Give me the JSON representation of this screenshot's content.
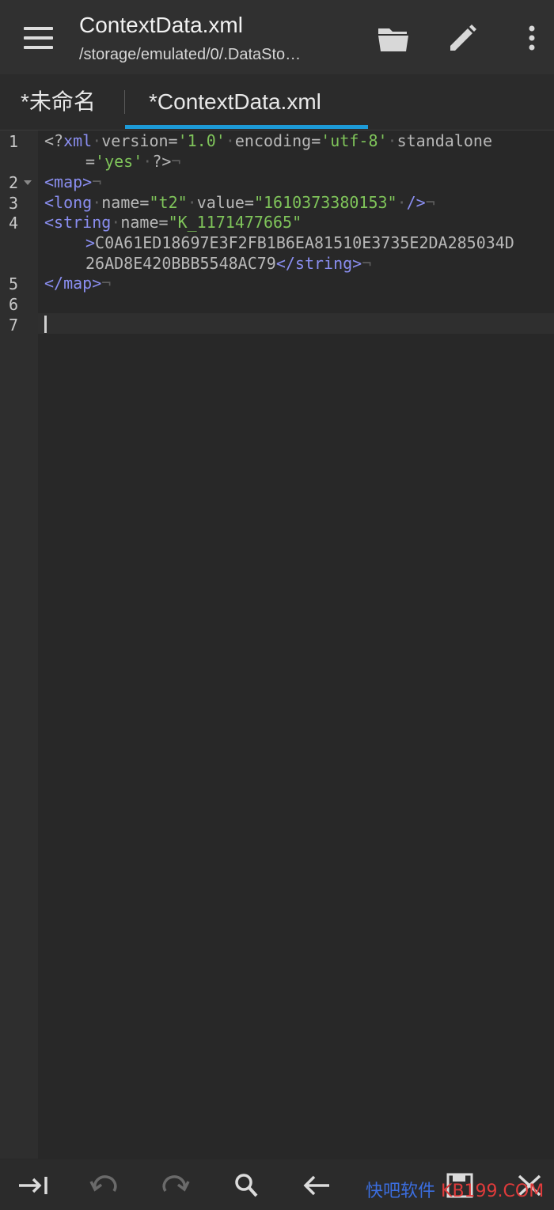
{
  "header": {
    "title": "ContextData.xml",
    "subtitle": "/storage/emulated/0/.DataSto…",
    "icons": [
      "menu-icon",
      "folder-open-icon",
      "pencil-icon",
      "more-vert-icon"
    ]
  },
  "tabs": [
    {
      "label": "*未命名",
      "active": false
    },
    {
      "label": "*ContextData.xml",
      "active": true
    }
  ],
  "editor": {
    "line_numbers": [
      "1",
      "2",
      "3",
      "4",
      "5",
      "6",
      "7"
    ],
    "line1a": {
      "p1": "<?",
      "t1": "xml",
      "d1": "·",
      "a1": "version=",
      "s1": "'1.0'",
      "d2": "·",
      "a2": "encoding=",
      "s2": "'utf-8'",
      "d3": "·",
      "a3": "standalone"
    },
    "line1b": {
      "a1": "=",
      "s1": "'yes'",
      "d1": "·",
      "p1": "?>",
      "e": "¬"
    },
    "line2": {
      "t1": "<map>",
      "e": "¬"
    },
    "line3": {
      "t1": "<long",
      "d1": "·",
      "a1": "name=",
      "s1": "\"t2\"",
      "d2": "·",
      "a2": "value=",
      "s2": "\"1610373380153\"",
      "d3": "·",
      "t2": "/>",
      "e": "¬"
    },
    "line4a": {
      "t1": "<string",
      "d1": "·",
      "a1": "name=",
      "s1": "\"K_1171477665\""
    },
    "line4b": {
      "t1": ">",
      "v": "C0A61ED18697E3F2FB1B6EA81510E3735E2DA285034D"
    },
    "line4c": {
      "v": "26AD8E420BBB5548AC79",
      "t1": "</string>",
      "e": "¬"
    },
    "line5": {
      "t1": "</map>",
      "e": "¬"
    }
  },
  "toolbar": {
    "icons": [
      "tab-indent-icon",
      "undo-icon",
      "redo-icon",
      "search-icon",
      "arrow-left-icon",
      "save-icon",
      "close-icon"
    ]
  },
  "watermark": {
    "cn": "快吧软件",
    "en": "KB199.COM"
  },
  "colors": {
    "accent": "#1d9bd8",
    "tag": "#8a8ef0",
    "string": "#7fc45a",
    "background": "#282828"
  }
}
